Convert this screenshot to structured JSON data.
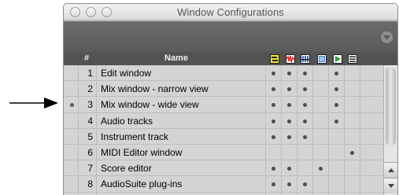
{
  "window": {
    "title": "Window Configurations"
  },
  "table": {
    "headers": {
      "number": "#",
      "name": "Name"
    },
    "column_icons": [
      "edit-window-icon",
      "mix-window-icon",
      "mixer-faders-icon",
      "score-icon",
      "transport-play-icon",
      "list-icon"
    ],
    "rows": [
      {
        "number": "1",
        "name": "Edit window",
        "active": false,
        "cols": [
          true,
          true,
          true,
          false,
          true,
          false
        ]
      },
      {
        "number": "2",
        "name": "Mix window - narrow view",
        "active": false,
        "cols": [
          true,
          true,
          true,
          false,
          true,
          false
        ]
      },
      {
        "number": "3",
        "name": "Mix window - wide view",
        "active": true,
        "cols": [
          true,
          true,
          true,
          false,
          true,
          false
        ]
      },
      {
        "number": "4",
        "name": "Audio tracks",
        "active": false,
        "cols": [
          true,
          true,
          true,
          false,
          true,
          false
        ]
      },
      {
        "number": "5",
        "name": "Instrument track",
        "active": false,
        "cols": [
          true,
          true,
          true,
          false,
          false,
          false
        ]
      },
      {
        "number": "6",
        "name": "MIDI Editor window",
        "active": false,
        "cols": [
          false,
          false,
          false,
          false,
          false,
          true
        ]
      },
      {
        "number": "7",
        "name": "Score editor",
        "active": false,
        "cols": [
          true,
          true,
          false,
          true,
          false,
          false
        ]
      },
      {
        "number": "8",
        "name": "AudioSuite plug-ins",
        "active": false,
        "cols": [
          true,
          true,
          true,
          false,
          false,
          false
        ]
      }
    ]
  },
  "colors": {
    "header_bg": "#535353",
    "toolbar_bg": "#636363",
    "row_bg": "#d4d4d4"
  }
}
